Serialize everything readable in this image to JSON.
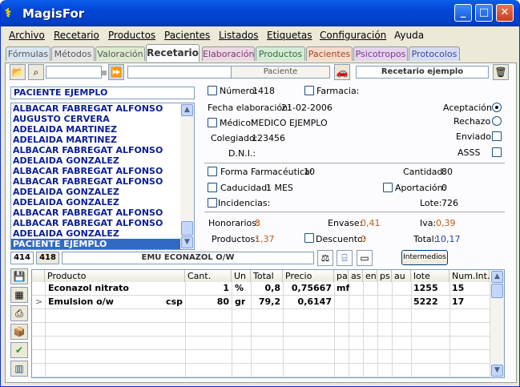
{
  "window": {
    "title": "MagisFor",
    "minimize": "_",
    "maximize": "□",
    "close": "✕"
  },
  "menu": [
    "Archivo",
    "Recetario",
    "Productos",
    "Pacientes",
    "Listados",
    "Etiquetas",
    "Configuración",
    "Ayuda"
  ],
  "tabs": [
    "Fórmulas",
    "Métodos",
    "Valoración",
    "Recetario",
    "Elaboración",
    "Productos",
    "Pacientes",
    "Psicotropos",
    "Protocolos"
  ],
  "active_tab": "Recetario",
  "toolbar": {
    "paciente_field": "Paciente",
    "recetario_field": "Recetario ejemplo"
  },
  "patient_search": "PACIENTE EJEMPLO",
  "patients": [
    "ALBACAR FABREGAT ALFONSO",
    "AUGUSTO CERVERA",
    "ADELAIDA MARTINEZ",
    "ADELAIDA MARTINEZ",
    "ALBACAR FABREGAT ALFONSO",
    "ADELAIDA GONZALEZ",
    "ALBACAR FABREGAT ALFONSO",
    "ALBACAR FABREGAT ALFONSO",
    "ADELAIDA GONZALEZ",
    "ADELAIDA GONZALEZ",
    "ALBACAR FABREGAT ALFONSO",
    "ALBACAR FABREGAT ALFONSO",
    "ADELAIDA GONZALEZ",
    "PACIENTE EJEMPLO"
  ],
  "selected_patient": "PACIENTE EJEMPLO",
  "record": {
    "numero_label": "Número:",
    "numero": "1418",
    "farmacia_label": "Farmacia:",
    "fecha_label": "Fecha elaboración:",
    "fecha": "21-02-2006",
    "medico_label": "Médico:",
    "medico": "MEDICO EJEMPLO",
    "colegiado_label": "Colegiado:",
    "colegiado": "123456",
    "dni_label": "D.N.I.:",
    "aceptacion": "Aceptación",
    "rechazo": "Rechazo",
    "enviado": "Enviado",
    "asss": "ASSS",
    "forma_label": "Forma Farmacéutica:",
    "forma": "10",
    "cantidad_label": "Cantidad:",
    "cantidad": "80",
    "caducidad_label": "Caducidad:",
    "caducidad": "1 MES",
    "aportacion_label": "Aportación:",
    "aportacion": "0",
    "incidencias_label": "Incidencias:",
    "lote_label": "Lote:",
    "lote": "726",
    "honorarios_label": "Honorarios:",
    "honorarios": "8",
    "envase_label": "Envase:",
    "envase": "0,41",
    "iva_label": "Iva:",
    "iva": "0,39",
    "productos_label": "Productos:",
    "productos": "1,37",
    "descuento_label": "Descuento:",
    "descuento": "0",
    "total_label": "Total:",
    "total": "10,17"
  },
  "formula_bar": {
    "code1": "414",
    "code2": "418",
    "name": "EMU ECONAZOL O/W",
    "intermedios": "Intermedios"
  },
  "grid": {
    "columns": [
      "Producto",
      "Cant.",
      "Un",
      "Total",
      "Precio",
      "pa",
      "as",
      "en",
      "ps",
      "au",
      "lote",
      "Num.Int."
    ],
    "rows": [
      {
        "marker": "",
        "producto": "Econazol nitrato",
        "extra": "",
        "cant": "1",
        "un": "%",
        "total": "0,8",
        "precio": "0,75667",
        "pa": "mf",
        "lote": "1255",
        "numint": "15"
      },
      {
        "marker": ">",
        "producto": "Emulsion o/w",
        "extra": "csp",
        "cant": "80",
        "un": "gr",
        "total": "79,2",
        "precio": "0,6147",
        "pa": "",
        "lote": "5222",
        "numint": "17"
      }
    ]
  }
}
